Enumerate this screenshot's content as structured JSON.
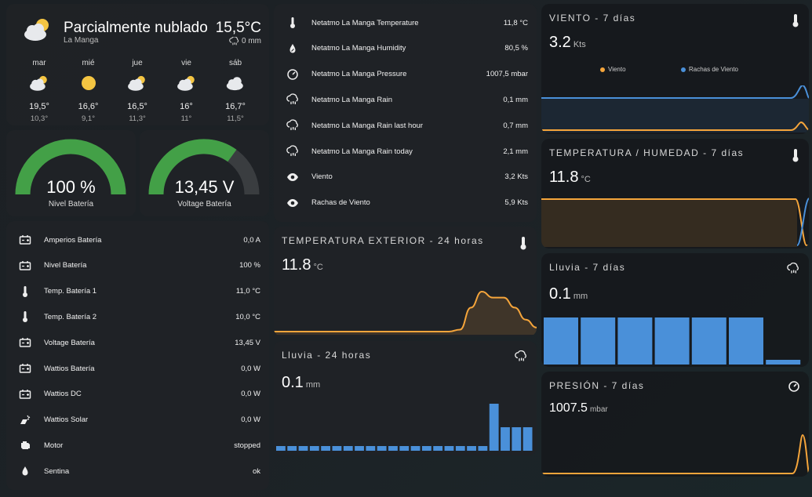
{
  "weather": {
    "condition": "Parcialmente nublado",
    "location": "La Manga",
    "temperature": "15,5°C",
    "rain": "0 mm",
    "forecast": [
      {
        "day": "mar",
        "icon": "partly-cloudy-icon",
        "high": "19,5°",
        "low": "10,3°"
      },
      {
        "day": "mié",
        "icon": "sunny-icon",
        "high": "16,6°",
        "low": "9,1°"
      },
      {
        "day": "jue",
        "icon": "partly-cloudy-icon",
        "high": "16,5°",
        "low": "11,3°"
      },
      {
        "day": "vie",
        "icon": "partly-cloudy-icon",
        "high": "16°",
        "low": "11°"
      },
      {
        "day": "sáb",
        "icon": "cloudy-icon",
        "high": "16,7°",
        "low": "11,5°"
      }
    ]
  },
  "gauges": {
    "battery_level": {
      "value": "100 %",
      "label": "Nivel Batería",
      "fraction": 1.0
    },
    "battery_voltage": {
      "value": "13,45 V",
      "label": "Voltage Batería",
      "fraction": 0.7
    }
  },
  "battery_entities": [
    {
      "icon": "battery-icon",
      "name": "Amperios Batería",
      "value": "0,0 A"
    },
    {
      "icon": "battery-icon",
      "name": "Nivel Batería",
      "value": "100 %"
    },
    {
      "icon": "thermometer-icon",
      "name": "Temp. Batería 1",
      "value": "11,0 °C"
    },
    {
      "icon": "thermometer-icon",
      "name": "Temp. Batería 2",
      "value": "10,0 °C"
    },
    {
      "icon": "battery-icon",
      "name": "Voltage Batería",
      "value": "13,45 V"
    },
    {
      "icon": "battery-icon",
      "name": "Wattios Batería",
      "value": "0,0 W"
    },
    {
      "icon": "battery-icon",
      "name": "Wattios DC",
      "value": "0,0 W"
    },
    {
      "icon": "solar-power-icon",
      "name": "Wattios Solar",
      "value": "0,0 W"
    },
    {
      "icon": "engine-icon",
      "name": "Motor",
      "value": "stopped"
    },
    {
      "icon": "water-drop-icon",
      "name": "Sentina",
      "value": "ok"
    }
  ],
  "netatmo_entities": [
    {
      "icon": "thermometer-icon",
      "name": "Netatmo La Manga Temperature",
      "value": "11,8 °C"
    },
    {
      "icon": "water-percent-icon",
      "name": "Netatmo La Manga Humidity",
      "value": "80,5 %"
    },
    {
      "icon": "gauge-icon",
      "name": "Netatmo La Manga Pressure",
      "value": "1007,5 mbar"
    },
    {
      "icon": "rain-cloud-icon",
      "name": "Netatmo La Manga Rain",
      "value": "0,1 mm"
    },
    {
      "icon": "rain-cloud-icon",
      "name": "Netatmo La Manga Rain last hour",
      "value": "0,7 mm"
    },
    {
      "icon": "rain-cloud-icon",
      "name": "Netatmo La Manga Rain today",
      "value": "2,1 mm"
    },
    {
      "icon": "eye-icon",
      "name": "Viento",
      "value": "3,2 Kts"
    },
    {
      "icon": "eye-icon",
      "name": "Rachas de Viento",
      "value": "5,9 Kts"
    }
  ],
  "graphs": {
    "temp_ext": {
      "title": "TEMPERATURA EXTERIOR - 24 horas",
      "value": "11.8",
      "unit": "°C",
      "icon": "thermometer-icon"
    },
    "lluvia_24": {
      "title": "Lluvia - 24 horas",
      "value": "0.1",
      "unit": "mm",
      "icon": "rain-cloud-icon"
    },
    "viento": {
      "title": "VIENTO - 7 días",
      "value": "3.2",
      "unit": "Kts",
      "icon": "thermometer-icon",
      "legend": [
        "Viento",
        "Rachas de Viento"
      ]
    },
    "temp_hum": {
      "title": "TEMPERATURA / HUMEDAD - 7 días",
      "value": "11.8",
      "unit": "°C",
      "icon": "thermometer-icon"
    },
    "lluvia_7": {
      "title": "Lluvia - 7 días",
      "value": "0.1",
      "unit": "mm",
      "icon": "rain-cloud-icon"
    },
    "presion": {
      "title": "PRESIÓN - 7 días",
      "value": "1007.5",
      "unit": "mbar",
      "icon": "gauge-icon"
    }
  },
  "colors": {
    "orange": "#f5a53b",
    "blue": "#4a90d9",
    "green": "#43a047"
  },
  "chart_data": [
    {
      "type": "area",
      "name": "temp_ext",
      "y": [
        0,
        0,
        0,
        0,
        0,
        0,
        0,
        0,
        0,
        0,
        0,
        0,
        0,
        0,
        0,
        0,
        0,
        0.05,
        0.6,
        1.0,
        0.85,
        0.85,
        0.6,
        0.3,
        0.1
      ]
    },
    {
      "type": "bar",
      "name": "lluvia_24",
      "values": [
        0.1,
        0.1,
        0.1,
        0.1,
        0.1,
        0.1,
        0.1,
        0.1,
        0.1,
        0.1,
        0.1,
        0.1,
        0.1,
        0.1,
        0.1,
        0.1,
        0.1,
        0.1,
        0.1,
        1.0,
        0.5,
        0.5,
        0.5
      ]
    },
    {
      "type": "bar",
      "name": "lluvia_7",
      "values": [
        1,
        1,
        1,
        1,
        1,
        1,
        0.1
      ]
    }
  ]
}
